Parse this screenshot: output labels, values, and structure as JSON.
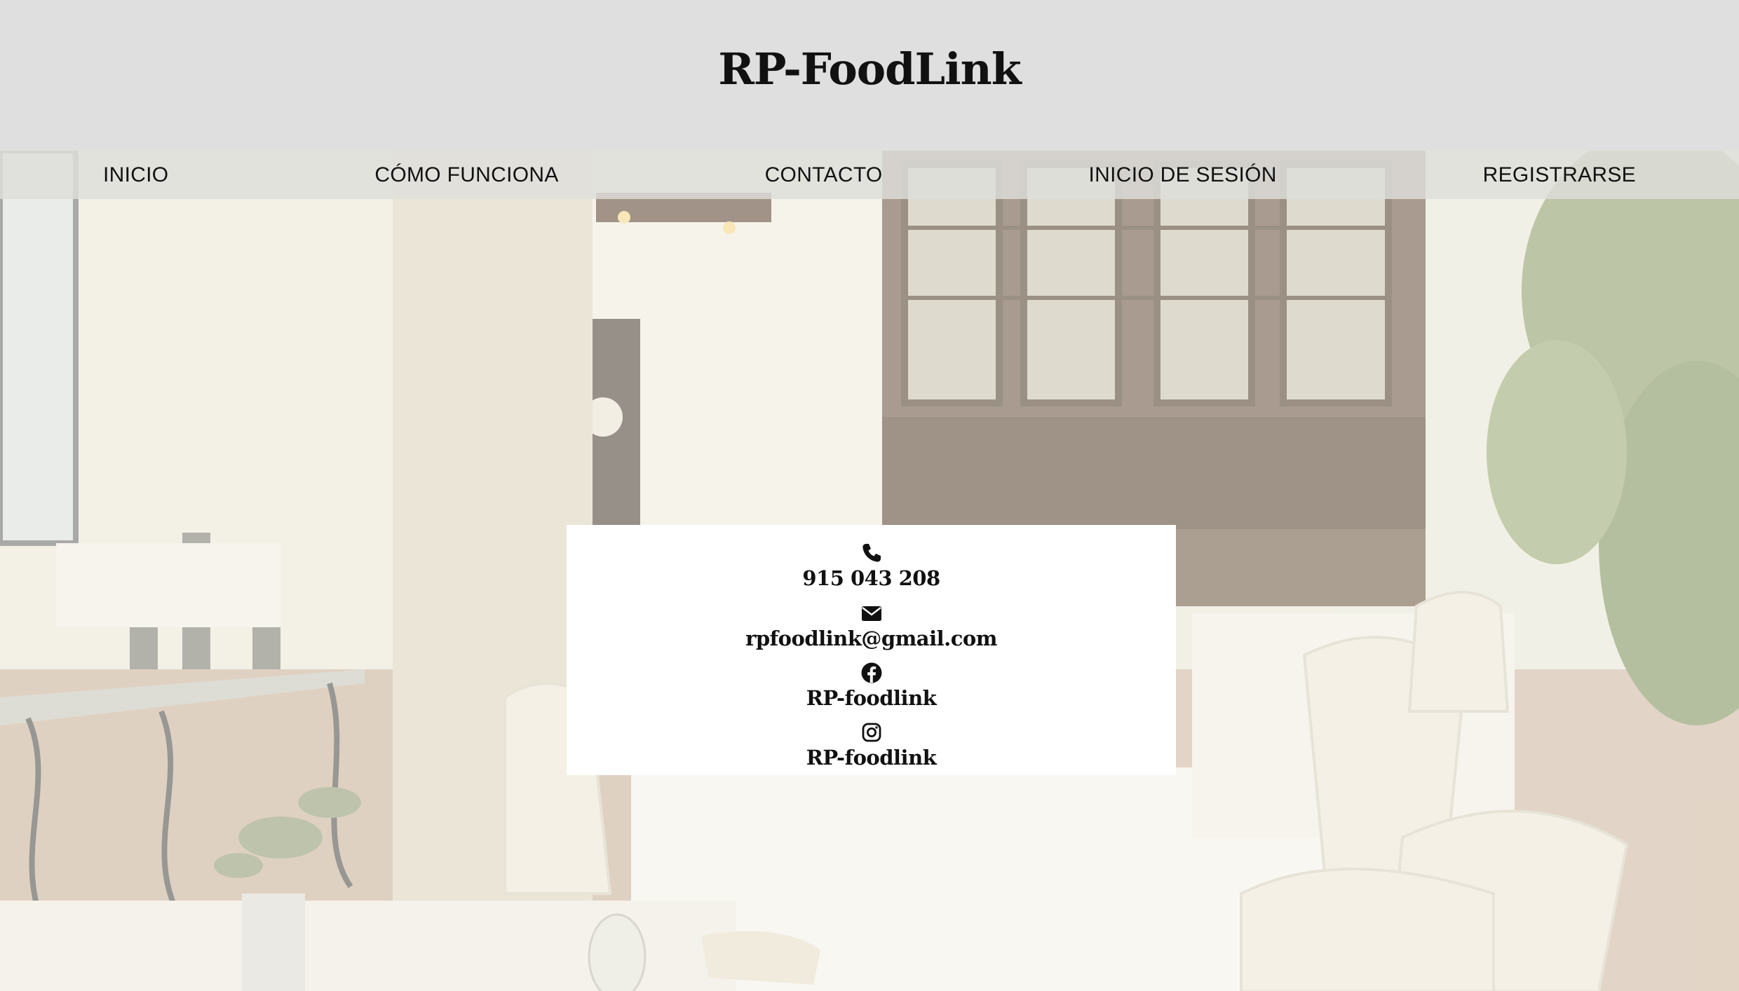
{
  "header": {
    "brand": "RP-FoodLink"
  },
  "nav": {
    "items": [
      {
        "label": "INICIO"
      },
      {
        "label": "CÓMO FUNCIONA"
      },
      {
        "label": "CONTACTO"
      },
      {
        "label": "INICIO DE SESIÓN"
      },
      {
        "label": "REGISTRARSE"
      }
    ]
  },
  "contact": {
    "phone": {
      "icon": "phone-icon",
      "text": "915 043 208"
    },
    "email": {
      "icon": "envelope-icon",
      "text": "rpfoodlink@gmail.com"
    },
    "facebook": {
      "icon": "facebook-icon",
      "text": "RP-foodlink"
    },
    "instagram": {
      "icon": "instagram-icon",
      "text": "RP-foodlink"
    }
  },
  "colors": {
    "header_bg": "#dfdfdf",
    "nav_bg": "#dededa",
    "card_bg": "#ffffff",
    "text": "#111111"
  }
}
